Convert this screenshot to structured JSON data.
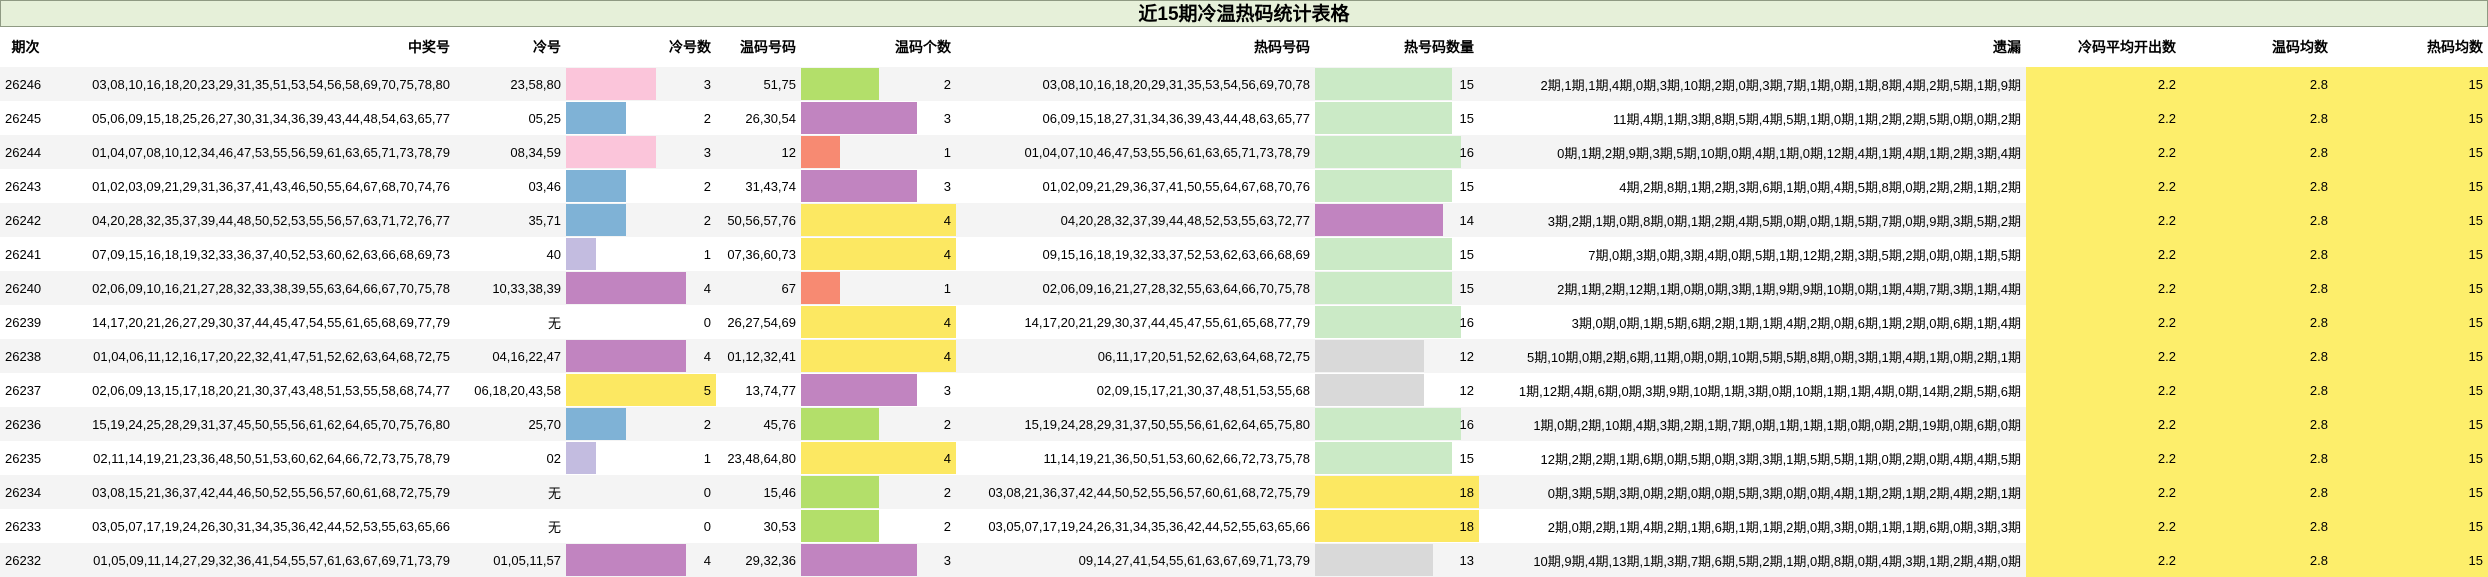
{
  "title": "近15期冷温热码统计表格",
  "headers": [
    "期次",
    "中奖号",
    "冷号",
    "冷号数",
    "温码号码",
    "温码个数",
    "热码号码",
    "热号码数量",
    "遗漏",
    "冷码平均开出数",
    "温码均数",
    "热码均数"
  ],
  "colors": {
    "c1": "#c3bce0",
    "c2": "#7fb2d6",
    "c3": "#fbc5da",
    "c4": "#c184c0",
    "c5": "#fce862",
    "w1": "#f78a72",
    "w2": "#b3df6a",
    "w3": "#c184c0",
    "w4": "#fce862",
    "h12": "#d9d9d9",
    "h13": "#d9d9d9",
    "h14": "#c184c0",
    "h15": "#cbeac6",
    "h16": "#cbeac6",
    "h18": "#fce862",
    "avg": "#fdee6b"
  },
  "rows": [
    {
      "qi": "26246",
      "win": "03,08,10,16,18,20,23,29,31,35,51,53,54,56,58,69,70,75,78,80",
      "cold": "23,58,80",
      "cold_n": 3,
      "warm": "51,75",
      "warm_n": 2,
      "hot": "03,08,10,16,18,20,29,31,35,53,54,56,69,70,78",
      "hot_n": 15,
      "miss": "2期,1期,1期,4期,0期,3期,10期,2期,0期,3期,7期,1期,0期,1期,8期,4期,2期,5期,1期,9期",
      "ca": "2.2",
      "wa": "2.8",
      "ha": "15"
    },
    {
      "qi": "26245",
      "win": "05,06,09,15,18,25,26,27,30,31,34,36,39,43,44,48,54,63,65,77",
      "cold": "05,25",
      "cold_n": 2,
      "warm": "26,30,54",
      "warm_n": 3,
      "hot": "06,09,15,18,27,31,34,36,39,43,44,48,63,65,77",
      "hot_n": 15,
      "miss": "11期,4期,1期,3期,8期,5期,4期,5期,1期,0期,1期,2期,2期,5期,0期,0期,2期",
      "ca": "2.2",
      "wa": "2.8",
      "ha": "15"
    },
    {
      "qi": "26244",
      "win": "01,04,07,08,10,12,34,46,47,53,55,56,59,61,63,65,71,73,78,79",
      "cold": "08,34,59",
      "cold_n": 3,
      "warm": "12",
      "warm_n": 1,
      "hot": "01,04,07,10,46,47,53,55,56,61,63,65,71,73,78,79",
      "hot_n": 16,
      "miss": "0期,1期,2期,9期,3期,5期,10期,0期,4期,1期,0期,12期,4期,1期,4期,1期,2期,3期,4期",
      "ca": "2.2",
      "wa": "2.8",
      "ha": "15"
    },
    {
      "qi": "26243",
      "win": "01,02,03,09,21,29,31,36,37,41,43,46,50,55,64,67,68,70,74,76",
      "cold": "03,46",
      "cold_n": 2,
      "warm": "31,43,74",
      "warm_n": 3,
      "hot": "01,02,09,21,29,36,37,41,50,55,64,67,68,70,76",
      "hot_n": 15,
      "miss": "4期,2期,8期,1期,2期,3期,6期,1期,0期,4期,5期,8期,0期,2期,2期,1期,2期",
      "ca": "2.2",
      "wa": "2.8",
      "ha": "15"
    },
    {
      "qi": "26242",
      "win": "04,20,28,32,35,37,39,44,48,50,52,53,55,56,57,63,71,72,76,77",
      "cold": "35,71",
      "cold_n": 2,
      "warm": "50,56,57,76",
      "warm_n": 4,
      "hot": "04,20,28,32,37,39,44,48,52,53,55,63,72,77",
      "hot_n": 14,
      "miss": "3期,2期,1期,0期,8期,0期,1期,2期,4期,5期,0期,0期,1期,5期,7期,0期,9期,3期,5期,2期",
      "ca": "2.2",
      "wa": "2.8",
      "ha": "15"
    },
    {
      "qi": "26241",
      "win": "07,09,15,16,18,19,32,33,36,37,40,52,53,60,62,63,66,68,69,73",
      "cold": "40",
      "cold_n": 1,
      "warm": "07,36,60,73",
      "warm_n": 4,
      "hot": "09,15,16,18,19,32,33,37,52,53,62,63,66,68,69",
      "hot_n": 15,
      "miss": "7期,0期,3期,0期,3期,4期,0期,5期,1期,12期,2期,3期,5期,2期,0期,0期,1期,5期",
      "ca": "2.2",
      "wa": "2.8",
      "ha": "15"
    },
    {
      "qi": "26240",
      "win": "02,06,09,10,16,21,27,28,32,33,38,39,55,63,64,66,67,70,75,78",
      "cold": "10,33,38,39",
      "cold_n": 4,
      "warm": "67",
      "warm_n": 1,
      "hot": "02,06,09,16,21,27,28,32,55,63,64,66,70,75,78",
      "hot_n": 15,
      "miss": "2期,1期,2期,12期,1期,0期,0期,3期,1期,9期,9期,10期,0期,1期,4期,7期,3期,1期,4期",
      "ca": "2.2",
      "wa": "2.8",
      "ha": "15"
    },
    {
      "qi": "26239",
      "win": "14,17,20,21,26,27,29,30,37,44,45,47,54,55,61,65,68,69,77,79",
      "cold": "无",
      "cold_n": 0,
      "warm": "26,27,54,69",
      "warm_n": 4,
      "hot": "14,17,20,21,29,30,37,44,45,47,55,61,65,68,77,79",
      "hot_n": 16,
      "miss": "3期,0期,0期,1期,5期,6期,2期,1期,1期,4期,2期,0期,6期,1期,2期,0期,6期,1期,4期",
      "ca": "2.2",
      "wa": "2.8",
      "ha": "15"
    },
    {
      "qi": "26238",
      "win": "01,04,06,11,12,16,17,20,22,32,41,47,51,52,62,63,64,68,72,75",
      "cold": "04,16,22,47",
      "cold_n": 4,
      "warm": "01,12,32,41",
      "warm_n": 4,
      "hot": "06,11,17,20,51,52,62,63,64,68,72,75",
      "hot_n": 12,
      "miss": "5期,10期,0期,2期,6期,11期,0期,0期,10期,5期,5期,8期,0期,3期,1期,4期,1期,0期,2期,1期",
      "ca": "2.2",
      "wa": "2.8",
      "ha": "15"
    },
    {
      "qi": "26237",
      "win": "02,06,09,13,15,17,18,20,21,30,37,43,48,51,53,55,58,68,74,77",
      "cold": "06,18,20,43,58",
      "cold_n": 5,
      "warm": "13,74,77",
      "warm_n": 3,
      "hot": "02,09,15,17,21,30,37,48,51,53,55,68",
      "hot_n": 12,
      "miss": "1期,12期,4期,6期,0期,3期,9期,10期,1期,3期,0期,10期,1期,1期,4期,0期,14期,2期,5期,6期",
      "ca": "2.2",
      "wa": "2.8",
      "ha": "15"
    },
    {
      "qi": "26236",
      "win": "15,19,24,25,28,29,31,37,45,50,55,56,61,62,64,65,70,75,76,80",
      "cold": "25,70",
      "cold_n": 2,
      "warm": "45,76",
      "warm_n": 2,
      "hot": "15,19,24,28,29,31,37,50,55,56,61,62,64,65,75,80",
      "hot_n": 16,
      "miss": "1期,0期,2期,10期,4期,3期,2期,1期,7期,0期,1期,1期,1期,0期,0期,2期,19期,0期,6期,0期",
      "ca": "2.2",
      "wa": "2.8",
      "ha": "15"
    },
    {
      "qi": "26235",
      "win": "02,11,14,19,21,23,36,48,50,51,53,60,62,64,66,72,73,75,78,79",
      "cold": "02",
      "cold_n": 1,
      "warm": "23,48,64,80",
      "warm_n": 4,
      "hot": "11,14,19,21,36,50,51,53,60,62,66,72,73,75,78",
      "hot_n": 15,
      "miss": "12期,2期,2期,1期,6期,0期,5期,0期,3期,3期,1期,5期,5期,1期,0期,2期,0期,4期,4期,5期",
      "ca": "2.2",
      "wa": "2.8",
      "ha": "15"
    },
    {
      "qi": "26234",
      "win": "03,08,15,21,36,37,42,44,46,50,52,55,56,57,60,61,68,72,75,79",
      "cold": "无",
      "cold_n": 0,
      "warm": "15,46",
      "warm_n": 2,
      "hot": "03,08,21,36,37,42,44,50,52,55,56,57,60,61,68,72,75,79",
      "hot_n": 18,
      "miss": "0期,3期,5期,3期,0期,2期,0期,0期,5期,3期,0期,0期,4期,1期,2期,1期,2期,4期,2期,1期",
      "ca": "2.2",
      "wa": "2.8",
      "ha": "15"
    },
    {
      "qi": "26233",
      "win": "03,05,07,17,19,24,26,30,31,34,35,36,42,44,52,53,55,63,65,66",
      "cold": "无",
      "cold_n": 0,
      "warm": "30,53",
      "warm_n": 2,
      "hot": "03,05,07,17,19,24,26,31,34,35,36,42,44,52,55,63,65,66",
      "hot_n": 18,
      "miss": "2期,0期,2期,1期,4期,2期,1期,6期,1期,1期,2期,0期,3期,0期,1期,1期,6期,0期,3期,3期",
      "ca": "2.2",
      "wa": "2.8",
      "ha": "15"
    },
    {
      "qi": "26232",
      "win": "01,05,09,11,14,27,29,32,36,41,54,55,57,61,63,67,69,71,73,79",
      "cold": "01,05,11,57",
      "cold_n": 4,
      "warm": "29,32,36",
      "warm_n": 3,
      "hot": "09,14,27,41,54,55,61,63,67,69,71,73,79",
      "hot_n": 13,
      "miss": "10期,9期,4期,13期,1期,3期,7期,6期,5期,2期,1期,0期,8期,0期,4期,3期,1期,2期,4期,0期",
      "ca": "2.2",
      "wa": "2.8",
      "ha": "15"
    }
  ]
}
